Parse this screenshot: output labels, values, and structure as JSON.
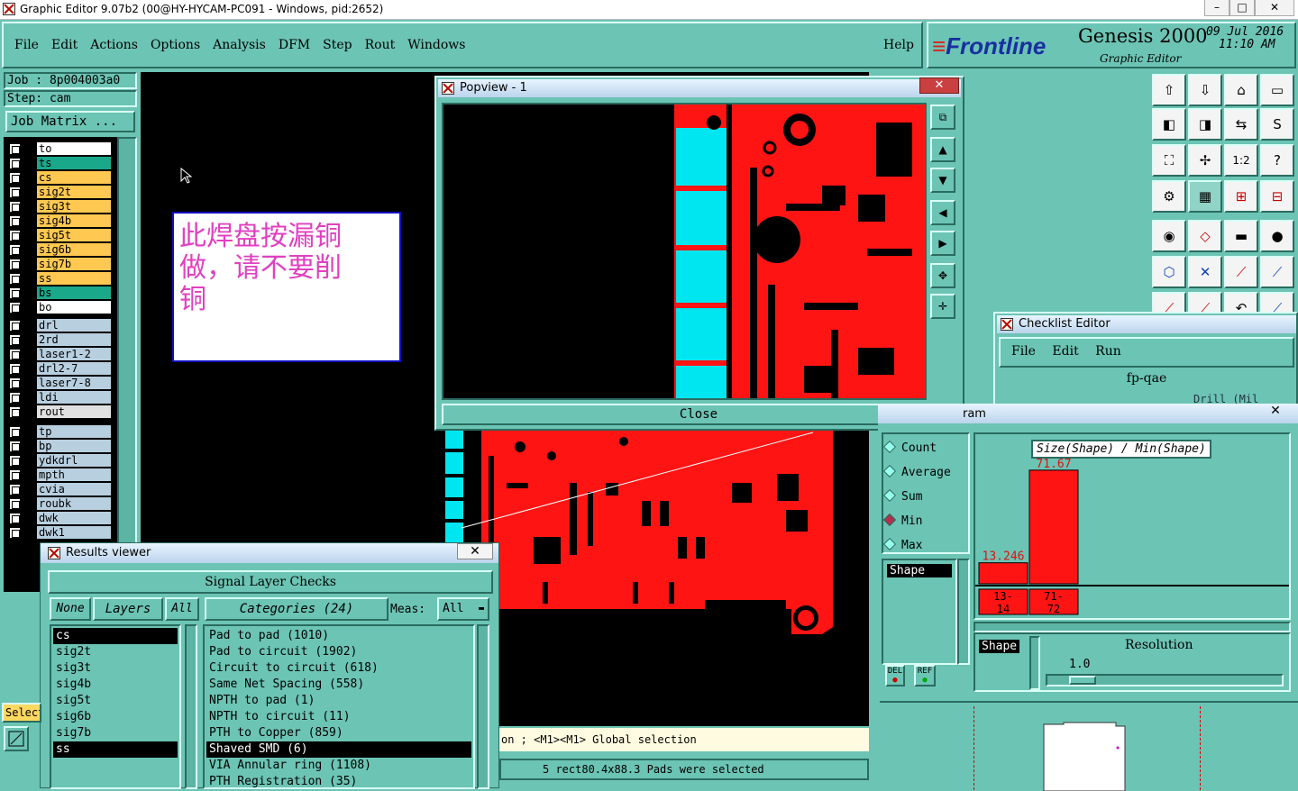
{
  "window": {
    "title": "Graphic Editor 9.07b2 (00@HY-HYCAM-PC091 - Windows, pid:2652)"
  },
  "menubar": {
    "items": [
      "File",
      "Edit",
      "Actions",
      "Options",
      "Analysis",
      "DFM",
      "Step",
      "Rout",
      "Windows"
    ],
    "help": "Help"
  },
  "brand": {
    "logo": "Frontline",
    "product": "Genesis 2000",
    "subtitle": "Graphic Editor",
    "date": "09 Jul 2016",
    "time": "11:10 AM"
  },
  "job": {
    "job_label": "Job : 8p004003a0",
    "step_label": "Step: cam",
    "matrix_button": "Job Matrix ..."
  },
  "layers": {
    "group1": [
      {
        "name": "to",
        "color": "#ffffff"
      },
      {
        "name": "ts",
        "color": "#1aa88a"
      },
      {
        "name": "cs",
        "color": "#ffc850"
      },
      {
        "name": "sig2t",
        "color": "#ffc850"
      },
      {
        "name": "sig3t",
        "color": "#ffc850"
      },
      {
        "name": "sig4b",
        "color": "#ffc850"
      },
      {
        "name": "sig5t",
        "color": "#ffc850"
      },
      {
        "name": "sig6b",
        "color": "#ffc850"
      },
      {
        "name": "sig7b",
        "color": "#ffc850"
      },
      {
        "name": "ss",
        "color": "#ffc850"
      },
      {
        "name": "bs",
        "color": "#1aa88a"
      },
      {
        "name": "bo",
        "color": "#ffffff"
      }
    ],
    "group2": [
      {
        "name": "drl",
        "color": "#b8cfe0"
      },
      {
        "name": "2rd",
        "color": "#b8cfe0"
      },
      {
        "name": "laser1-2",
        "color": "#b8cfe0"
      },
      {
        "name": "drl2-7",
        "color": "#b8cfe0"
      },
      {
        "name": "laser7-8",
        "color": "#b8cfe0"
      },
      {
        "name": "ldi",
        "color": "#b8cfe0"
      },
      {
        "name": "rout",
        "color": "#e0e0e0"
      }
    ],
    "group3": [
      {
        "name": "tp",
        "color": "#b8cfe0"
      },
      {
        "name": "bp",
        "color": "#b8cfe0"
      },
      {
        "name": "ydkdrl",
        "color": "#b8cfe0"
      },
      {
        "name": "mpth",
        "color": "#b8cfe0"
      },
      {
        "name": "cvia",
        "color": "#b8cfe0"
      },
      {
        "name": "roubk",
        "color": "#b8cfe0"
      },
      {
        "name": "dwk",
        "color": "#b8cfe0"
      },
      {
        "name": "dwk1",
        "color": "#b8cfe0"
      }
    ]
  },
  "note": {
    "text": "此焊盘按漏铜做，请不要削铜"
  },
  "popview": {
    "title": "Popview - 1",
    "close_label": "Close"
  },
  "checklist": {
    "title": "Checklist Editor",
    "menu": [
      "File",
      "Edit",
      "Run"
    ],
    "name": "fp-qae",
    "row_text": "Drill (Mil"
  },
  "histogram": {
    "title_partial": "ram",
    "modes": [
      "Count",
      "Average",
      "Sum",
      "Min",
      "Max"
    ],
    "selected_mode": "Min",
    "shape_list": [
      "Shape"
    ],
    "chart_title": "Size(Shape) / Min(Shape)",
    "resolution_label": "Resolution",
    "resolution_value": "1.0",
    "del_label": "DEL",
    "ref_label": "REF",
    "x_selector": "Shape"
  },
  "chart_data": {
    "type": "bar",
    "title": "Size(Shape) / Min(Shape)",
    "categories": [
      "13-14",
      "71-72"
    ],
    "values": [
      13.246,
      71.67
    ],
    "value_labels": [
      "13.246",
      "71.67"
    ],
    "ylim": [
      0,
      75
    ]
  },
  "results": {
    "title": "Results viewer",
    "header": "Signal Layer Checks",
    "none_label": "None",
    "layers_label": "Layers",
    "all_label": "All",
    "categories_label": "Categories (24)",
    "meas_label": "Meas:",
    "meas_value": "All",
    "layers": [
      "cs",
      "sig2t",
      "sig3t",
      "sig4b",
      "sig5t",
      "sig6b",
      "sig7b",
      "ss"
    ],
    "selected_layers": [
      "cs",
      "ss"
    ],
    "categories": [
      "Pad to pad (1010)",
      "Pad to circuit (1902)",
      "Circuit to circuit (618)",
      "Same Net Spacing (558)",
      "NPTH to pad (1)",
      "NPTH to circuit (11)",
      "PTH to Copper (859)",
      "Shaved SMD (6)",
      "VIA Annular ring (1108)",
      "PTH Registration (35)"
    ],
    "selected_category": "Shaved SMD (6)"
  },
  "status": {
    "line1": "on ; <M1><M1> Global selection",
    "line2": "5 rect80.4x88.3 Pads were selected",
    "select_label": "Select"
  },
  "colors": {
    "panel": "#6cc4b4",
    "canvas": "#000000",
    "copper": "#ff1414",
    "pad_cyan": "#00e6f0",
    "note_text": "#e040c0"
  }
}
